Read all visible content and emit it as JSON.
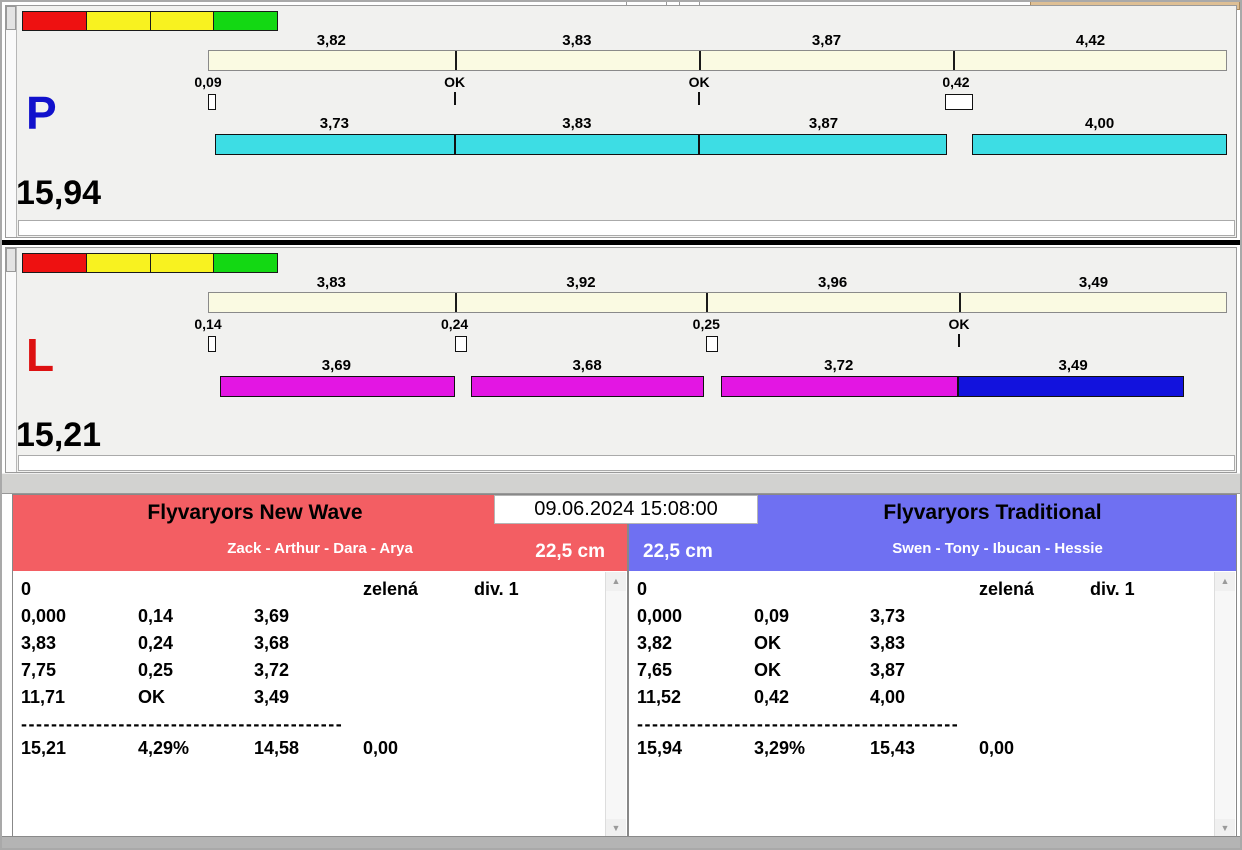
{
  "timestamp": "09.06.2024 15:08:00",
  "lanes": [
    {
      "letter": "P",
      "letter_color": "#1111cc",
      "total": "15,94",
      "split_times": [
        "3,82",
        "3,83",
        "3,87",
        "4,42"
      ],
      "markers": [
        "0,09",
        "OK",
        "OK",
        "0,42"
      ],
      "lap_times": [
        "3,73",
        "3,83",
        "3,87",
        "4,00"
      ],
      "bar_color": "#3ddde4"
    },
    {
      "letter": "L",
      "letter_color": "#dd1111",
      "total": "15,21",
      "split_times": [
        "3,83",
        "3,92",
        "3,96",
        "3,49"
      ],
      "markers": [
        "0,14",
        "0,24",
        "0,25",
        "OK"
      ],
      "lap_times": [
        "3,69",
        "3,68",
        "3,72",
        "3,49"
      ],
      "bar_color": "#e316e3",
      "last_lap_color": "#1212dd"
    }
  ],
  "teams": [
    {
      "name": "Flyvaryors New Wave",
      "members": "Zack - Arthur - Dara - Arya",
      "distance": "22,5 cm",
      "header_color": "#f35e63",
      "info_row": {
        "start": "0",
        "color_word": "zelená",
        "division": "div. 1"
      },
      "rows": [
        [
          "0,000",
          "0,14",
          "3,69"
        ],
        [
          "3,83",
          "0,24",
          "3,68"
        ],
        [
          "7,75",
          "0,25",
          "3,72"
        ],
        [
          "11,71",
          "OK",
          "3,49"
        ]
      ],
      "divider": "-------------------------------------------",
      "totals": [
        "15,21",
        "4,29%",
        "14,58",
        "0,00"
      ]
    },
    {
      "name": "Flyvaryors Traditional",
      "members": "Swen - Tony - Ibucan - Hessie",
      "distance": "22,5 cm",
      "header_color": "#6f70f2",
      "info_row": {
        "start": "0",
        "color_word": "zelená",
        "division": "div. 1"
      },
      "rows": [
        [
          "0,000",
          "0,09",
          "3,73"
        ],
        [
          "3,82",
          "OK",
          "3,83"
        ],
        [
          "7,65",
          "OK",
          "3,87"
        ],
        [
          "11,52",
          "0,42",
          "4,00"
        ]
      ],
      "divider": "-------------------------------------------",
      "totals": [
        "15,94",
        "3,29%",
        "15,43",
        "0,00"
      ]
    }
  ],
  "scrollbar": {
    "up_glyph": "▲",
    "down_glyph": "▼"
  },
  "colors": {
    "traffic": [
      "#ee1111",
      "#f8f220",
      "#f8f220",
      "#13d813"
    ],
    "split_bar": "#fafae2",
    "lane_p_bar": "#3ddde4",
    "lane_l_bar": "#e316e3",
    "lane_l_last": "#1212dd"
  }
}
